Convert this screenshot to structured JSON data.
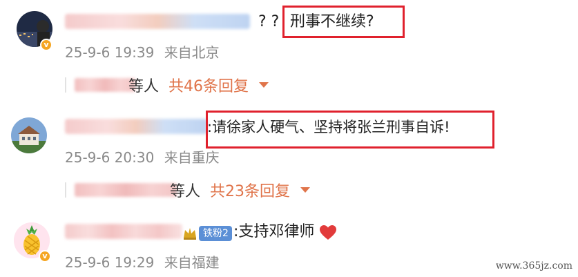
{
  "comments": [
    {
      "text": "??刑事不继续?",
      "prefix": "? ?",
      "highlighted_text": "刑事不继续?",
      "time": "25-9-6 19:39",
      "location": "来自北京",
      "reply_suffix": "等人",
      "reply_count": "共46条回复",
      "avatar_icon": "city-night-avatar",
      "verified_icon": "verified-badge-icon"
    },
    {
      "text": ":请徐家人硬气、坚持将张兰刑事自诉!",
      "highlighted_text": ":请徐家人硬气、坚持将张兰刑事自诉!",
      "time": "25-9-6 20:30",
      "location": "来自重庆",
      "reply_suffix": "等人",
      "reply_count": "共23条回复",
      "avatar_icon": "building-avatar"
    },
    {
      "text": ":支持邓律师",
      "fan_badge": "铁粉2",
      "time": "25-9-6 19:29",
      "location": "来自福建",
      "avatar_icon": "pineapple-avatar",
      "verified_icon": "verified-badge-icon",
      "emoji_icon": "heart-icon"
    }
  ],
  "colors": {
    "accent": "#e0744a",
    "highlight_border": "#e0212d",
    "meta_text": "#8a8a8a"
  },
  "watermark": "www.365jz.com"
}
